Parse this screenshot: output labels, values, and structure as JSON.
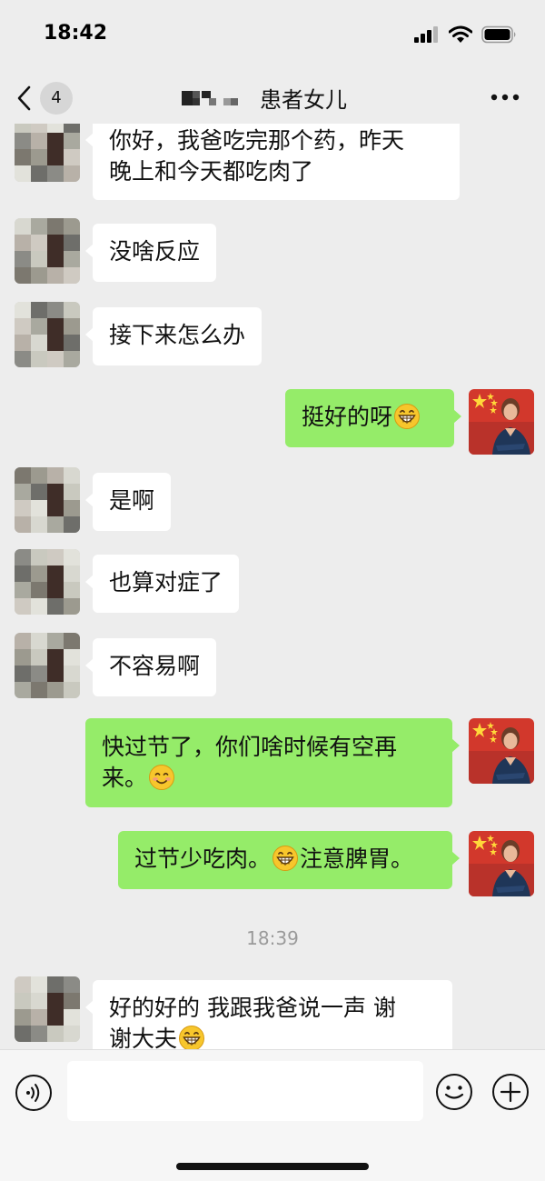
{
  "status_bar": {
    "time": "18:42"
  },
  "nav": {
    "back_badge": "4",
    "title": "患者女儿"
  },
  "messages": [
    {
      "side": "left",
      "lines": [
        "你好，我爸吃完那个药，昨天",
        "晚上和今天都吃肉了"
      ]
    },
    {
      "side": "left",
      "text": "没啥反应"
    },
    {
      "side": "left",
      "text": "接下来怎么办"
    },
    {
      "side": "right",
      "text": "挺好的呀"
    },
    {
      "side": "left",
      "text": "是啊"
    },
    {
      "side": "left",
      "text": "也算对症了"
    },
    {
      "side": "left",
      "text": "不容易啊"
    },
    {
      "side": "right",
      "lines": [
        "快过节了，你们啥时候有空再",
        "来。"
      ]
    },
    {
      "side": "right",
      "text_before": "过节少吃肉。",
      "text_after": "注意脾胃。"
    },
    {
      "side": "left",
      "lines": [
        "好的好的  我跟我爸说一声 谢",
        "谢大夫"
      ]
    }
  ],
  "timestamp": "18:39",
  "icons": {
    "back": "chevron-left-icon",
    "more": "more-dots-icon",
    "voice": "voice-icon",
    "emoji": "emoji-icon",
    "plus": "plus-icon",
    "grin": "grinning-emoji-icon",
    "smile": "smiling-emoji-icon"
  },
  "colors": {
    "outgoing_bubble": "#95ec69",
    "incoming_bubble": "#ffffff",
    "background": "#ededed"
  }
}
